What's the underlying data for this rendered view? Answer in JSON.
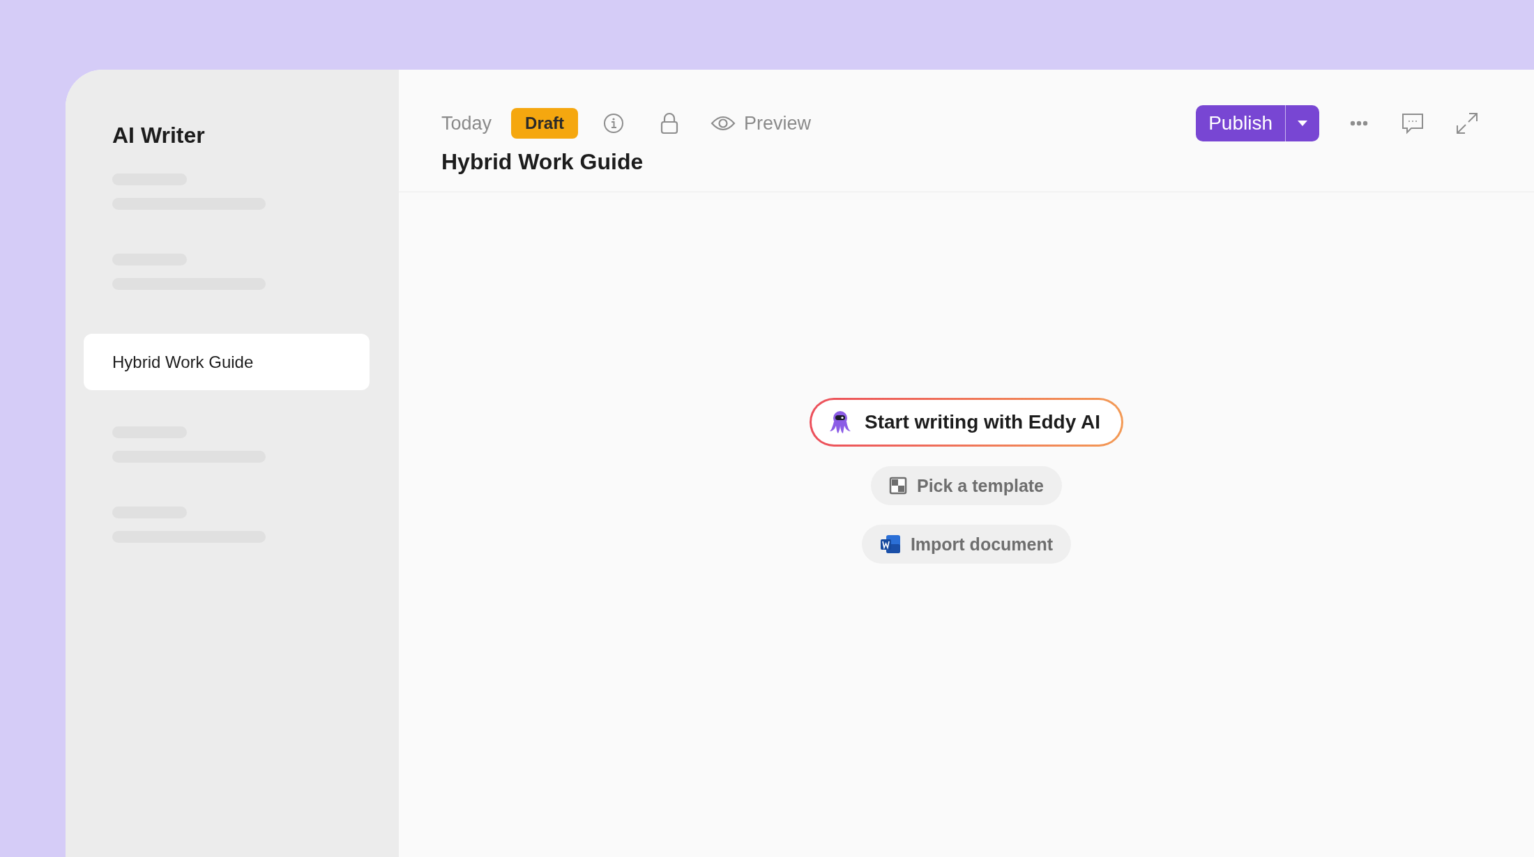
{
  "sidebar": {
    "title": "AI Writer",
    "items": [
      {
        "kind": "skeleton"
      },
      {
        "kind": "skeleton"
      },
      {
        "kind": "page",
        "label": "Hybrid Work Guide",
        "selected": true
      },
      {
        "kind": "skeleton"
      },
      {
        "kind": "skeleton"
      }
    ]
  },
  "toolbar": {
    "date": "Today",
    "status": "Draft",
    "preview": "Preview",
    "publish": "Publish"
  },
  "document": {
    "title": "Hybrid Work Guide"
  },
  "actions": [
    {
      "kind": "ai",
      "label": "Start writing with Eddy AI"
    },
    {
      "kind": "template",
      "label": "Pick a template"
    },
    {
      "kind": "import",
      "label": "Import document"
    }
  ]
}
